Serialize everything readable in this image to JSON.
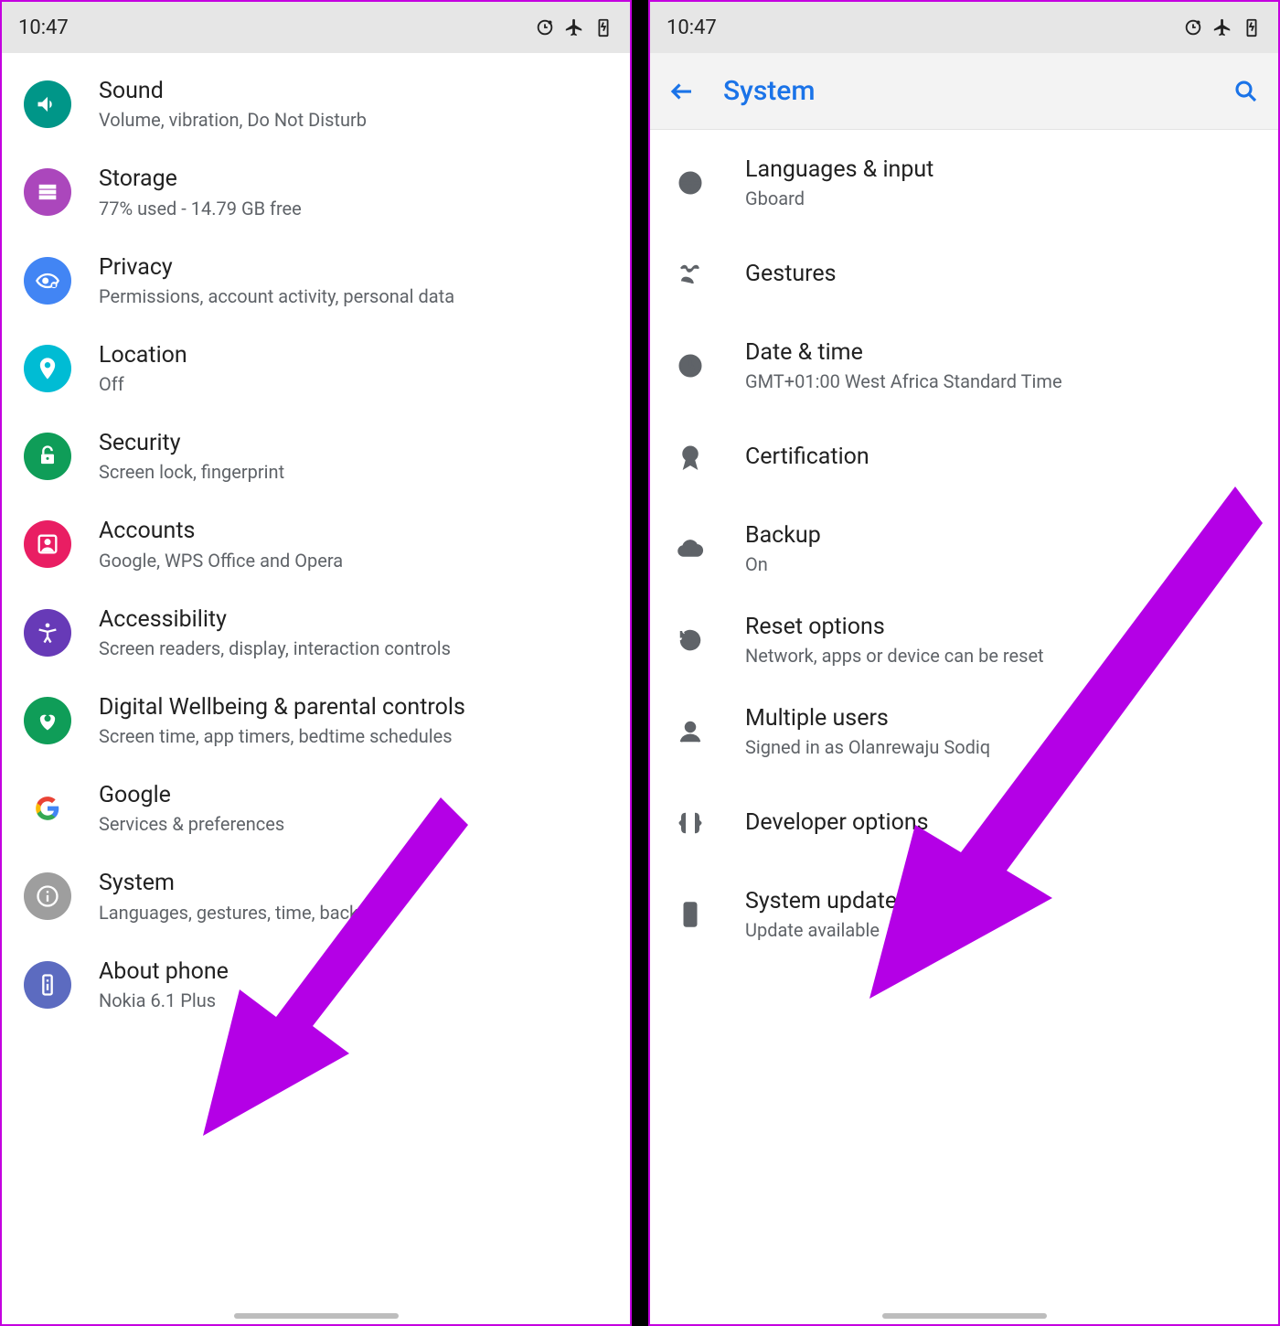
{
  "status": {
    "time": "10:47"
  },
  "left": {
    "items": [
      {
        "title": "Sound",
        "sub": "Volume, vibration, Do Not Disturb"
      },
      {
        "title": "Storage",
        "sub": "77% used - 14.79 GB free"
      },
      {
        "title": "Privacy",
        "sub": "Permissions, account activity, personal data"
      },
      {
        "title": "Location",
        "sub": "Off"
      },
      {
        "title": "Security",
        "sub": "Screen lock, fingerprint"
      },
      {
        "title": "Accounts",
        "sub": "Google, WPS Office and Opera"
      },
      {
        "title": "Accessibility",
        "sub": "Screen readers, display, interaction controls"
      },
      {
        "title": "Digital Wellbeing & parental controls",
        "sub": "Screen time, app timers, bedtime schedules"
      },
      {
        "title": "Google",
        "sub": "Services & preferences"
      },
      {
        "title": "System",
        "sub": "Languages, gestures, time, backup"
      },
      {
        "title": "About phone",
        "sub": "Nokia 6.1 Plus"
      }
    ]
  },
  "right": {
    "header": "System",
    "items": [
      {
        "title": "Languages & input",
        "sub": "Gboard"
      },
      {
        "title": "Gestures",
        "sub": ""
      },
      {
        "title": "Date & time",
        "sub": "GMT+01:00 West Africa Standard Time"
      },
      {
        "title": "Certification",
        "sub": ""
      },
      {
        "title": "Backup",
        "sub": "On"
      },
      {
        "title": "Reset options",
        "sub": "Network, apps or device can be reset"
      },
      {
        "title": "Multiple users",
        "sub": "Signed in as Olanrewaju Sodiq"
      },
      {
        "title": "Developer options",
        "sub": ""
      },
      {
        "title": "System update",
        "sub": "Update available"
      }
    ]
  }
}
